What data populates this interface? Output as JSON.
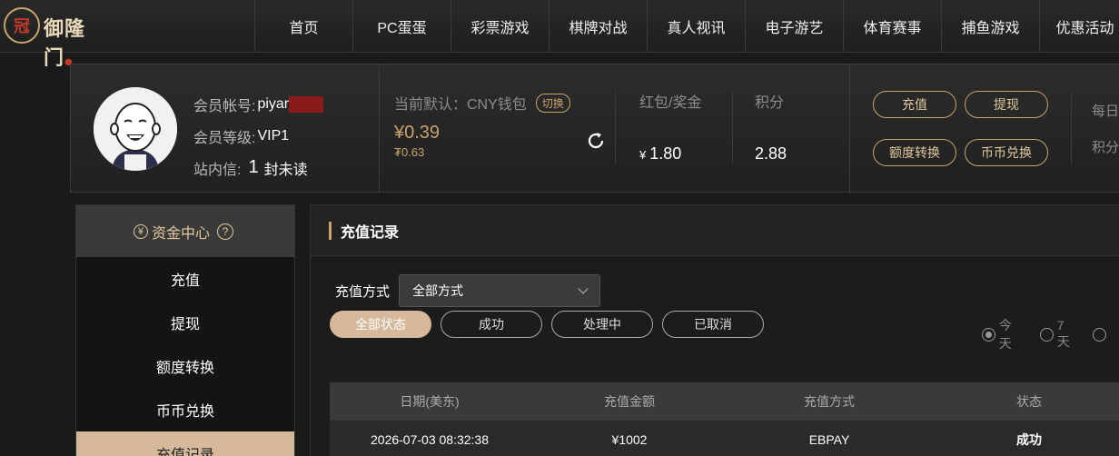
{
  "logo": {
    "mark": "冠",
    "text": "御隆门"
  },
  "nav": [
    "首页",
    "PC蛋蛋",
    "彩票游戏",
    "棋牌对战",
    "真人视讯",
    "电子游艺",
    "体育赛事",
    "捕鱼游戏",
    "优惠活动"
  ],
  "account": {
    "id_label": "会员帐号:",
    "id_value": "piyar",
    "level_label": "会员等级:",
    "level_value": "VIP1",
    "msg_label": "站内信:",
    "msg_count": "1",
    "msg_suffix": "封未读"
  },
  "wallet": {
    "label": "当前默认：CNY钱包",
    "switch": "切换",
    "balance": "¥0.39",
    "sub_balance": "₮0.63"
  },
  "stats": [
    {
      "label": "红包/奖金",
      "currency": "¥",
      "value": "1.80"
    },
    {
      "label": "积分",
      "currency": "",
      "value": "2.88"
    }
  ],
  "actions": [
    "充值",
    "提现",
    "额度转换",
    "币币兑换"
  ],
  "right_labels": [
    "每日",
    "积分"
  ],
  "sidebar": {
    "title": "资金中心",
    "items": [
      "充值",
      "提现",
      "额度转换",
      "币币兑换",
      "充值记录"
    ]
  },
  "main": {
    "title": "充值记录",
    "filter_label": "充值方式",
    "filter_value": "全部方式",
    "statuses": [
      "全部状态",
      "成功",
      "处理中",
      "已取消"
    ],
    "ranges": [
      "今天",
      "7天",
      ""
    ],
    "columns": [
      "日期(美东)",
      "充值金额",
      "充值方式",
      "状态"
    ],
    "rows": [
      [
        "2026-07-03 08:32:38",
        "¥1002",
        "EBPAY",
        "成功"
      ]
    ]
  },
  "colors": {
    "accent": "#c9a36b",
    "active_bg": "#d6b99a"
  }
}
